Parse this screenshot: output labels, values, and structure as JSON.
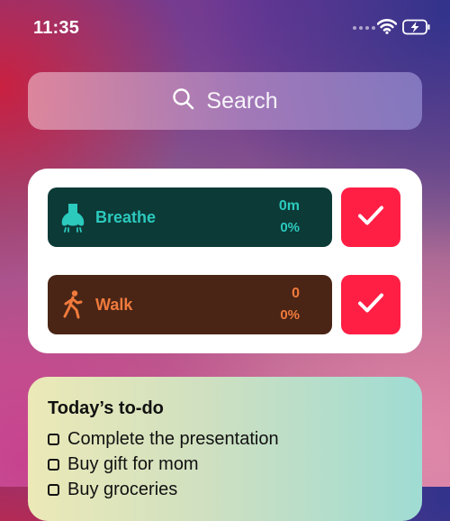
{
  "status_bar": {
    "time": "11:35"
  },
  "search": {
    "label": "Search"
  },
  "habits": [
    {
      "name": "Breathe",
      "value": "0m",
      "percent": "0%",
      "icon": "nose-icon",
      "bg": "#0c3a37",
      "fg": "#2cc9bd"
    },
    {
      "name": "Walk",
      "value": "0",
      "percent": "0%",
      "icon": "walking-person-icon",
      "bg": "#4a2516",
      "fg": "#f07a3c"
    }
  ],
  "check_button_color": "#ff1f45",
  "todo": {
    "title": "Today’s to-do",
    "items": [
      {
        "text": "Complete the presentation"
      },
      {
        "text": "Buy gift for mom"
      },
      {
        "text": "Buy groceries"
      }
    ]
  }
}
